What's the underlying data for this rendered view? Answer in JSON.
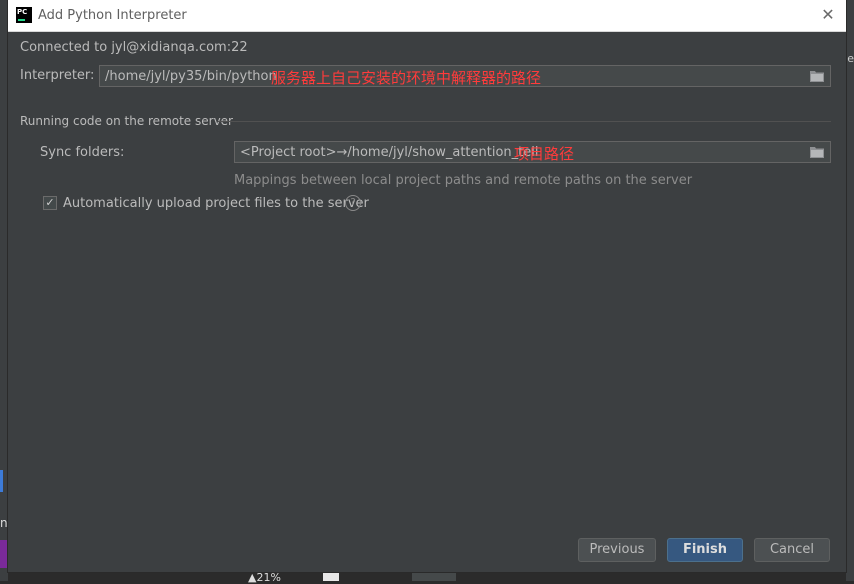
{
  "window": {
    "icon_text": "PC",
    "title": "Add Python Interpreter",
    "close_glyph": "✕"
  },
  "connection": {
    "text": "Connected to jyl@xidianqa.com:22"
  },
  "interpreter": {
    "label": "Interpreter:",
    "value": "/home/jyl/py35/bin/python",
    "annotation": "服务器上自己安装的环境中解释器的路径",
    "annotation_color": "#ff3b3b",
    "browse_icon": "folder-icon"
  },
  "remote_section": {
    "title": "Running code on the remote server",
    "sync_label": "Sync folders:",
    "sync_value": "<Project root>→/home/jyl/show_attention_tell",
    "sync_annotation": "项目路径",
    "mapping_hint": "Mappings between local project paths and remote paths on the server",
    "auto_upload": {
      "label": "Automatically upload project files to the server",
      "checked": true,
      "check_glyph": "✓",
      "help_glyph": "?"
    }
  },
  "buttons": {
    "previous": "Previous",
    "finish": "Finish",
    "cancel": "Cancel"
  },
  "background": {
    "left_fragment": "n",
    "right_fragment": "e",
    "bottom_fragment": "▲21%"
  },
  "colors": {
    "dialog_bg": "#3c3f41",
    "primary_button": "#365880",
    "text": "#bbbbbb"
  }
}
